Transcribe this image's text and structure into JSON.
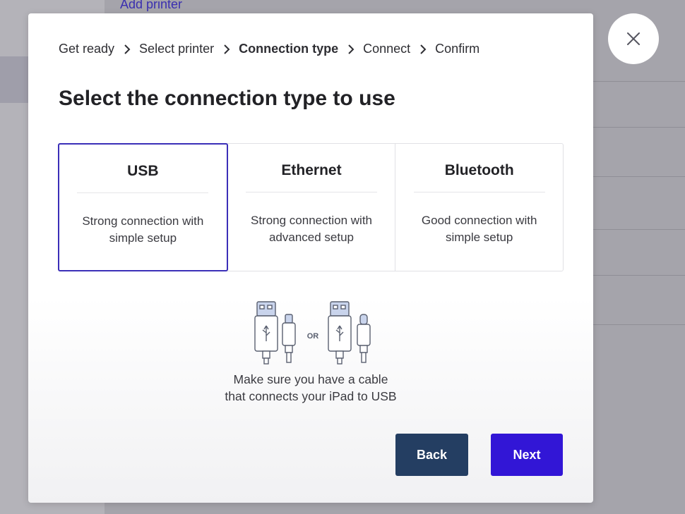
{
  "background": {
    "link_label": "Add printer"
  },
  "breadcrumb": [
    {
      "label": "Get ready",
      "active": false
    },
    {
      "label": "Select printer",
      "active": false
    },
    {
      "label": "Connection type",
      "active": true
    },
    {
      "label": "Connect",
      "active": false
    },
    {
      "label": "Confirm",
      "active": false
    }
  ],
  "title": "Select the connection type to use",
  "options": [
    {
      "name": "USB",
      "description": "Strong connection with simple setup",
      "selected": true
    },
    {
      "name": "Ethernet",
      "description": "Strong connection with advanced setup",
      "selected": false
    },
    {
      "name": "Bluetooth",
      "description": "Good connection with simple setup",
      "selected": false
    }
  ],
  "illustration": {
    "or_label": "OR",
    "icons": [
      "usb-lightning-cable-icon",
      "usb-c-cable-icon"
    ]
  },
  "note": {
    "line1": "Make sure you have a cable",
    "line2": "that connects your iPad to USB"
  },
  "buttons": {
    "back": "Back",
    "next": "Next"
  },
  "colors": {
    "accent": "#3216d6",
    "selected_border": "#3b2fb8",
    "back_button": "#243e62",
    "overlay": "#a5a4ab"
  }
}
